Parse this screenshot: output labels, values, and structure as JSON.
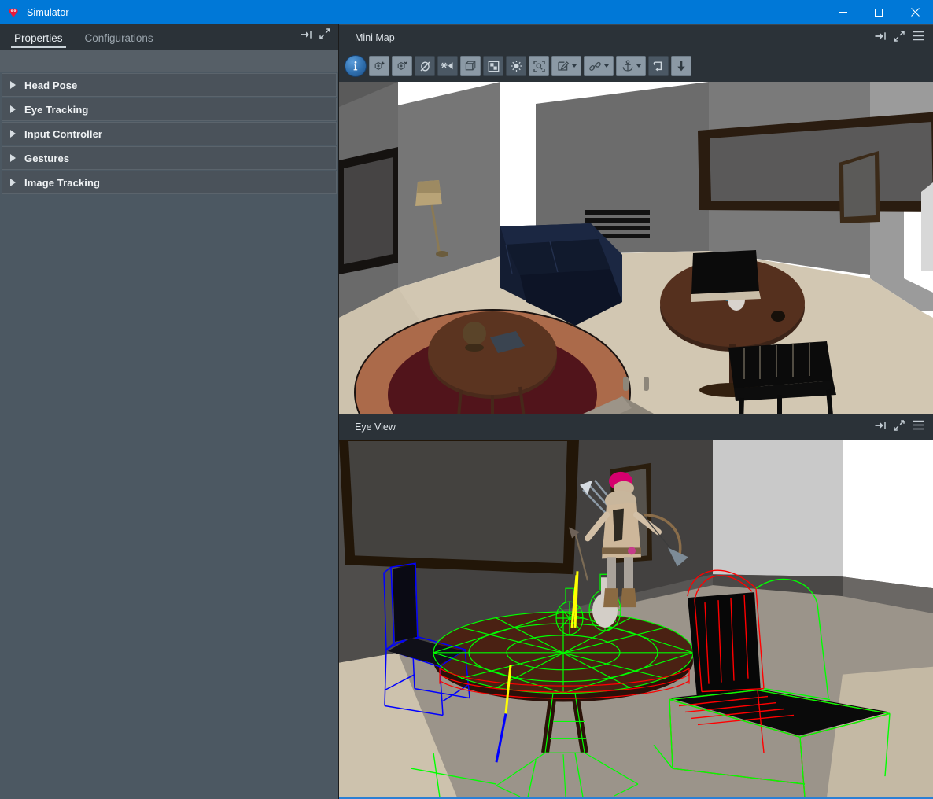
{
  "window": {
    "title": "Simulator",
    "icon": "simulator-app-icon",
    "accent_color": "#0078d7",
    "controls": [
      {
        "name": "minimize-button",
        "glyph": "—"
      },
      {
        "name": "maximize-button",
        "glyph": "□"
      },
      {
        "name": "close-button",
        "glyph": "✕"
      }
    ]
  },
  "left_dock": {
    "tabs": [
      {
        "label": "Properties",
        "active": true
      },
      {
        "label": "Configurations",
        "active": false
      }
    ],
    "header_icons": [
      {
        "name": "dock-collapse-icon",
        "title": "Collapse"
      },
      {
        "name": "expand-diagonal-icon",
        "title": "Expand"
      }
    ],
    "sections": [
      {
        "label": "Head Pose",
        "expanded": false
      },
      {
        "label": "Eye Tracking",
        "expanded": false
      },
      {
        "label": "Input Controller",
        "expanded": false
      },
      {
        "label": "Gestures",
        "expanded": false
      },
      {
        "label": "Image Tracking",
        "expanded": false
      }
    ]
  },
  "panels": [
    {
      "id": "mini-map",
      "title": "Mini Map",
      "header_icons": [
        {
          "name": "dock-collapse-icon"
        },
        {
          "name": "expand-diagonal-icon"
        },
        {
          "name": "hamburger-menu-icon"
        }
      ],
      "toolbar": [
        {
          "name": "info-button",
          "icon": "info-icon",
          "style": "round",
          "caret": false
        },
        {
          "name": "add-object-button",
          "icon": "object-plus-icon",
          "style": "light",
          "caret": false
        },
        {
          "name": "remove-object-button",
          "icon": "object-minus-icon",
          "style": "light",
          "caret": false
        },
        {
          "name": "hide-object-button",
          "icon": "eye-slash-icon",
          "style": "dark",
          "caret": false
        },
        {
          "name": "isolate-button",
          "icon": "sparkle-left-icon",
          "style": "dark",
          "caret": false
        },
        {
          "name": "bounding-box-button",
          "icon": "cube-outline-icon",
          "style": "light",
          "caret": false
        },
        {
          "name": "checkerboard-button",
          "icon": "checker-grid-icon",
          "style": "dark",
          "caret": false
        },
        {
          "name": "light-button",
          "icon": "lightbulb-icon",
          "style": "dark",
          "caret": false
        },
        {
          "name": "focus-button",
          "icon": "focus-target-icon",
          "style": "light",
          "caret": false
        },
        {
          "name": "edit-button",
          "icon": "pencil-square-icon",
          "style": "light",
          "caret": true
        },
        {
          "name": "link-button",
          "icon": "chain-link-icon",
          "style": "light",
          "caret": true
        },
        {
          "name": "anchor-button",
          "icon": "anchor-icon",
          "style": "light",
          "caret": true
        },
        {
          "name": "reload-button",
          "icon": "refresh-loop-icon",
          "style": "dark",
          "caret": false
        },
        {
          "name": "download-button",
          "icon": "arrow-down-icon",
          "style": "light",
          "caret": false
        }
      ],
      "viewport": {
        "description": "Third-person 3D room overview with gray walls, beige floor, navy sofa, floor lamp, framed pictures, oval rug with coffee table, dark round dining table with chairs and a red camera frustum gizmo.",
        "camera_frustum_color": "#ff0000",
        "secondary_gizmo_color": "#0000ff"
      }
    },
    {
      "id": "eye-view",
      "title": "Eye View",
      "header_icons": [
        {
          "name": "dock-collapse-icon"
        },
        {
          "name": "expand-diagonal-icon"
        },
        {
          "name": "hamburger-menu-icon"
        }
      ],
      "viewport": {
        "description": "First-person eye-tracking view of a dining table with two chairs overlaid by colored wireframe meshes and a small archer avatar standing on the table.",
        "wireframe_colors": {
          "chair_left": "#0000ff",
          "table_and_vases": "#00ff00",
          "chair_right": "#ff0000",
          "axis_line": "#ffff00",
          "floor_edge": "#00c8c8"
        },
        "avatar": {
          "name": "archer-avatar",
          "hat_color": "#d6006e",
          "tunic_color": "#cdb79a"
        },
        "focus_border_color": "#2b7fd4"
      }
    }
  ]
}
